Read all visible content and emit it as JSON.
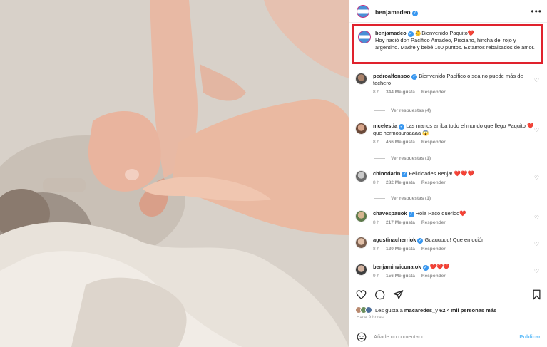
{
  "post": {
    "author": "benjamadeo",
    "caption_prefix": "👶Bienvenido Paquito❤️",
    "caption_body": "Hoy nació don Pacífico Amadeo, Pisciano, hincha del rojo y argentino. Madre y bebé 100 puntos. Estamos rebalsados de amor."
  },
  "comments": [
    {
      "user": "pedroalfonsoo",
      "text": "Bienvenido Pacífico o sea no puede más de fachero",
      "time": "8 h",
      "likes": "344 Me gusta",
      "reply": "Responder",
      "replies": "Ver respuestas (4)"
    },
    {
      "user": "mcelestia",
      "text": "Las manos arriba todo el mundo que llego Paquito ❤️ que hermosuraaaaa 😱",
      "time": "8 h",
      "likes": "466 Me gusta",
      "reply": "Responder",
      "replies": "Ver respuestas (1)"
    },
    {
      "user": "chinodarin",
      "text": "Felicidades Benja! ❤️❤️❤️",
      "time": "8 h",
      "likes": "282 Me gusta",
      "reply": "Responder",
      "replies": "Ver respuestas (1)"
    },
    {
      "user": "chavespauok",
      "text": "Hola Paco querido❤️",
      "time": "8 h",
      "likes": "217 Me gusta",
      "reply": "Responder",
      "replies": ""
    },
    {
      "user": "agustinacherriok",
      "text": "Guauuuuu! Que emoción",
      "time": "8 h",
      "likes": "120 Me gusta",
      "reply": "Responder",
      "replies": ""
    },
    {
      "user": "benjaminvicuna.ok",
      "text": "❤️❤️❤️",
      "time": "9 h",
      "likes": "156 Me gusta",
      "reply": "Responder",
      "replies": ""
    }
  ],
  "likes_bar": {
    "prefix": "Les gusta a",
    "first_user": "macaredes_",
    "joiner": "y",
    "others": "62,4 mil personas más"
  },
  "time_ago": "Hace 9 horas",
  "comment_box": {
    "placeholder": "Añade un comentario...",
    "publish": "Publicar"
  },
  "icons": {
    "more": "more-horizontal-icon",
    "heart": "heart-icon",
    "comment": "comment-icon",
    "share": "share-icon",
    "bookmark": "bookmark-icon",
    "emoji": "emoji-icon"
  },
  "colors": {
    "highlight_border": "#e0222d",
    "verified": "#3897f0",
    "link": "#0095f6",
    "muted": "#8e8e8e"
  }
}
